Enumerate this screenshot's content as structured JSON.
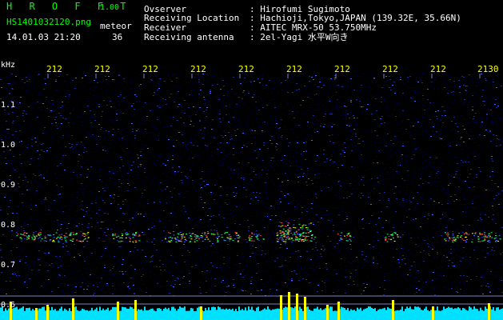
{
  "app": {
    "name": "HROFFT",
    "brand_text": "H R O F F T",
    "version": "1.00"
  },
  "file": {
    "name": "HS1401032120.png",
    "timestamp": "14.01.03 21:20",
    "category_label": "meteor",
    "meteor_count": "36"
  },
  "info": [
    {
      "label": "Ovserver",
      "value": ": Hirofumi Sugimoto"
    },
    {
      "label": "Receiving Location",
      "value": ": Hachioji,Tokyo,JAPAN (139.32E, 35.66N)"
    },
    {
      "label": "Receiver",
      "value": ": AITEC MRX-50 53.750MHz"
    },
    {
      "label": "Receiving antenna",
      "value": ": 2el-Yagi 水平W向き"
    }
  ],
  "spectrogram": {
    "y_unit": "kHz",
    "y_ticks": [
      "1.1",
      "1.0",
      "0.9",
      "0.8",
      "0.7",
      "0.6"
    ],
    "x_ticks": [
      "212",
      "212",
      "212",
      "212",
      "212",
      "212",
      "212",
      "212",
      "212",
      "2130"
    ],
    "colors": {
      "background": "#000000",
      "noise_dark": "#00003a",
      "noise": "#1a2a9a",
      "noise_bright": "#3f5fff",
      "echo": "#00ff66",
      "echo_hot": "#ff4040",
      "echo_warm": "#ffff00",
      "baseline": "#00e0ff",
      "peak": "#ffff00",
      "grid": "#8080c0"
    }
  }
}
